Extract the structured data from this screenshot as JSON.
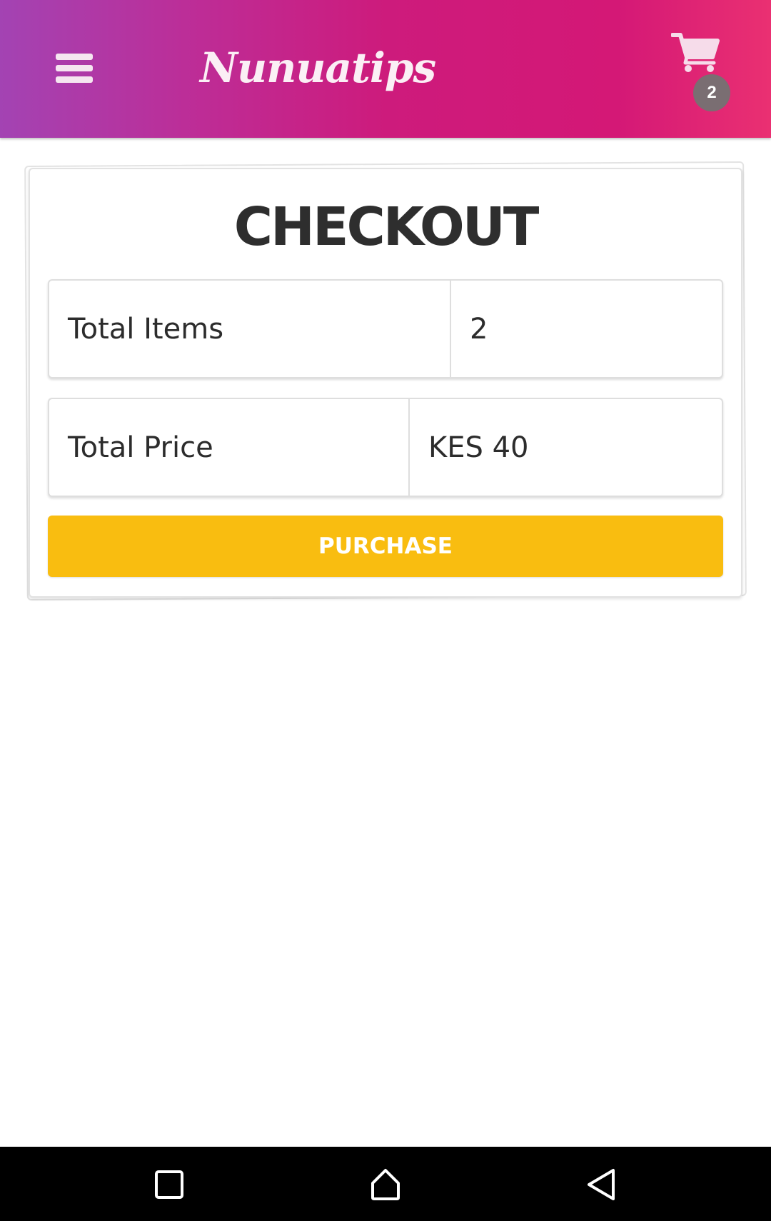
{
  "header": {
    "brand": "Nunuatips",
    "menu_icon": "hamburger-menu-icon",
    "cart_icon": "shopping-cart-icon",
    "cart_count": "2",
    "gradient_colors": [
      "#a343b3",
      "#cd1b7c",
      "#ea3072"
    ]
  },
  "checkout": {
    "title": "CHECKOUT",
    "rows": [
      {
        "label": "Total Items",
        "value": "2"
      },
      {
        "label": "Total Price",
        "value": "KES 40"
      }
    ],
    "purchase_label": "PURCHASE",
    "purchase_color": "#f9bd10"
  },
  "system_nav": {
    "recents_icon": "square-recents-icon",
    "home_icon": "home-icon",
    "back_icon": "triangle-back-icon"
  }
}
